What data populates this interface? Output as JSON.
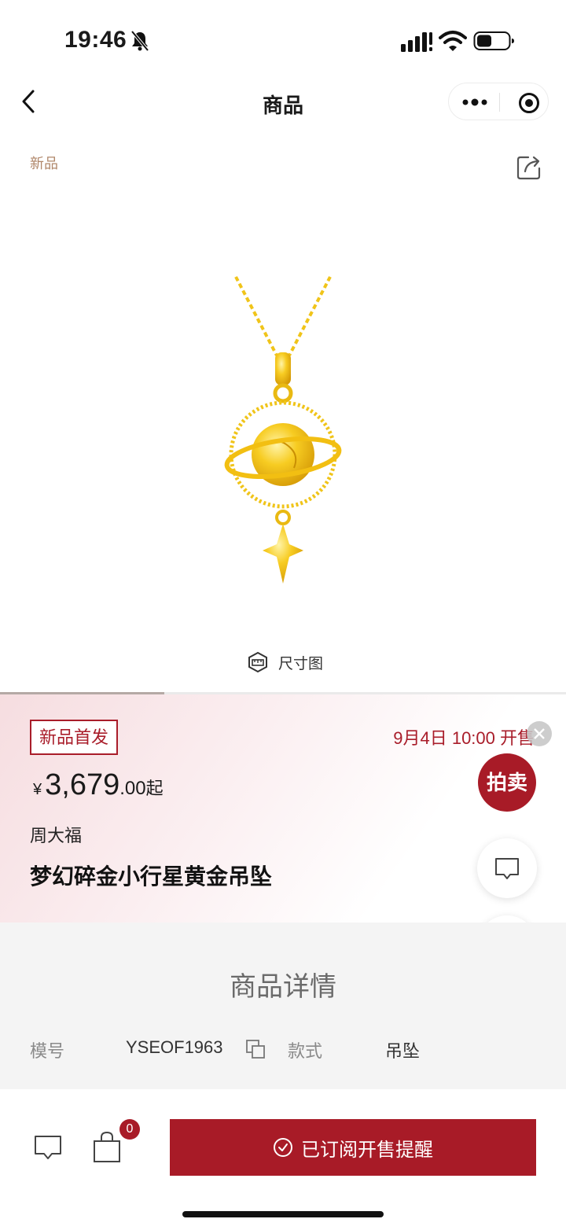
{
  "status_bar": {
    "time": "19:46"
  },
  "nav": {
    "title": "商品"
  },
  "gallery": {
    "tag": "新品",
    "size_chart_label": "尺寸图",
    "slide_progress": 0.29
  },
  "info": {
    "badge": "新品首发",
    "sale_time": "9月4日 10:00 开售",
    "price": {
      "currency": "¥",
      "main": "3,679",
      "decimal": ".00",
      "suffix": "起"
    },
    "brand": "周大福",
    "name": "梦幻碎金小行星黄金吊坠"
  },
  "floating": {
    "auction_label": "拍卖"
  },
  "details": {
    "title": "商品详情",
    "specs": [
      {
        "label": "模号",
        "value": "YSEOF1963"
      },
      {
        "label": "款式",
        "value": "吊坠"
      }
    ]
  },
  "bottom": {
    "cart_count": "0",
    "subscribe_label": "已订阅开售提醒"
  },
  "colors": {
    "accent": "#a81b27",
    "tag": "#b0876a"
  }
}
